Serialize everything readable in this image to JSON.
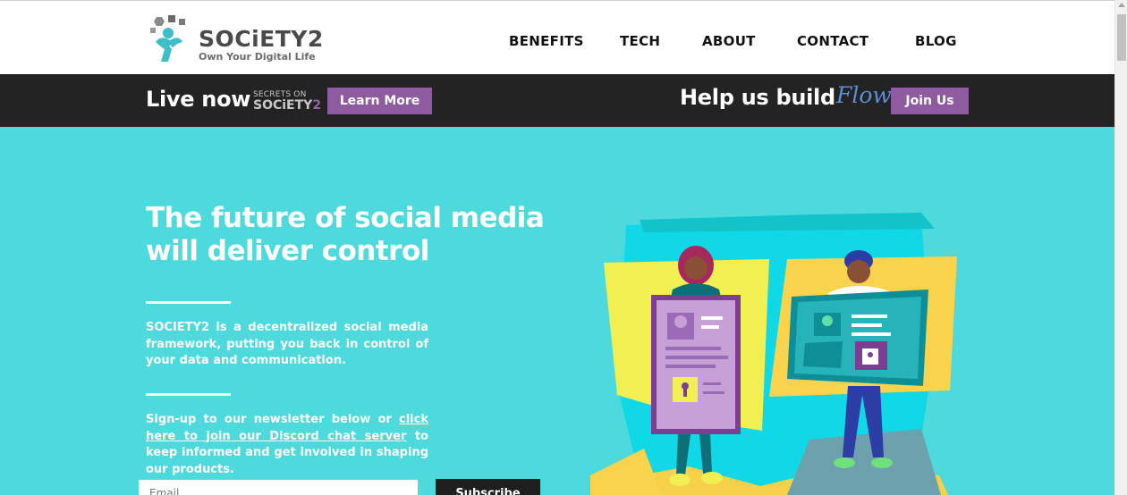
{
  "logo": {
    "name_main": "SOCiETY",
    "name_num": "2",
    "tagline": "Own Your Digital Life",
    "icon": "society2-figure-icon"
  },
  "nav": {
    "items": [
      {
        "label": "BENEFITS"
      },
      {
        "label": "TECH"
      },
      {
        "label": "ABOUT"
      },
      {
        "label": "CONTACT"
      },
      {
        "label": "BLOG"
      }
    ]
  },
  "promo": {
    "live_label": "Live now",
    "secrets_line": "SECRETS ON",
    "secrets_brand": "SOCiETY",
    "secrets_num": "2",
    "learn_more": "Learn More",
    "help_label": "Help us build",
    "flow_label": "Flow",
    "join_us": "Join Us"
  },
  "hero": {
    "title_line1": "The future of social media",
    "title_line2": "will deliver control",
    "description": "SOCIETY2 is a decentralized social media framework, putting you back in control of your data and communication.",
    "signup_prefix": "Sign-up to our newsletter below or ",
    "signup_link": "click here to join our Discord chat server",
    "signup_suffix": " to keep informed and get involved in shaping our products.",
    "email_placeholder": "Email",
    "subscribe_label": "Subscribe"
  },
  "colors": {
    "hero_bg": "#4edadc",
    "promo_bg": "#232323",
    "accent_purple": "#8e5aa0",
    "flow_blue": "#5b8fd6"
  }
}
